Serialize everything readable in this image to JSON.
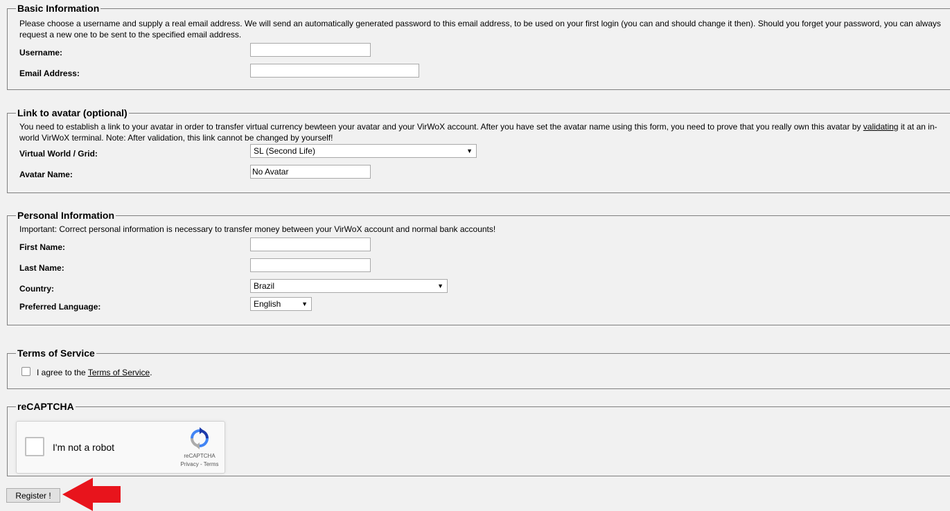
{
  "basic": {
    "legend": "Basic Information",
    "description": "Please choose a username and supply a real email address. We will send an automatically generated password to this email address, to be used on your first login (you can and should change it then). Should you forget your password, you can always request a new one to be sent to the specified email address.",
    "username_label": "Username:",
    "username_value": "",
    "email_label": "Email Address:",
    "email_value": ""
  },
  "avatar": {
    "legend": "Link to avatar (optional)",
    "description_before": "You need to establish a link to your avatar in order to transfer virtual currency bewteen your avatar and your VirWoX account. After you have set the avatar name using this form, you need to prove that you really own this avatar by ",
    "description_link": "validating",
    "description_after": " it at an in-world VirWoX terminal. Note: After validation, this link cannot be changed by yourself!",
    "world_label": "Virtual World / Grid:",
    "world_selected": "SL (Second Life)",
    "name_label": "Avatar Name:",
    "name_value": "No Avatar"
  },
  "personal": {
    "legend": "Personal Information",
    "description": "Important: Correct personal information is necessary to transfer money between your VirWoX account and normal bank accounts!",
    "first_name_label": "First Name:",
    "first_name_value": "",
    "last_name_label": "Last Name:",
    "last_name_value": "",
    "country_label": "Country:",
    "country_selected": "Brazil",
    "language_label": "Preferred Language:",
    "language_selected": "English"
  },
  "terms": {
    "legend": "Terms of Service",
    "agree_prefix": "I agree to the ",
    "agree_link": "Terms of Service",
    "agree_suffix": ".",
    "checked": false
  },
  "captcha": {
    "legend": "reCAPTCHA",
    "label": "I'm not a robot",
    "brand": "reCAPTCHA",
    "privacy": "Privacy",
    "separator": " - ",
    "terms": "Terms"
  },
  "register": {
    "label": "Register !"
  },
  "colors": {
    "background": "#f1f1f1",
    "arrow": "#e8141c",
    "border": "#7f7f7f"
  },
  "icons": {
    "dropdown": "triangle-down",
    "recaptcha": "recaptcha-logo",
    "pointer": "red-arrow"
  }
}
